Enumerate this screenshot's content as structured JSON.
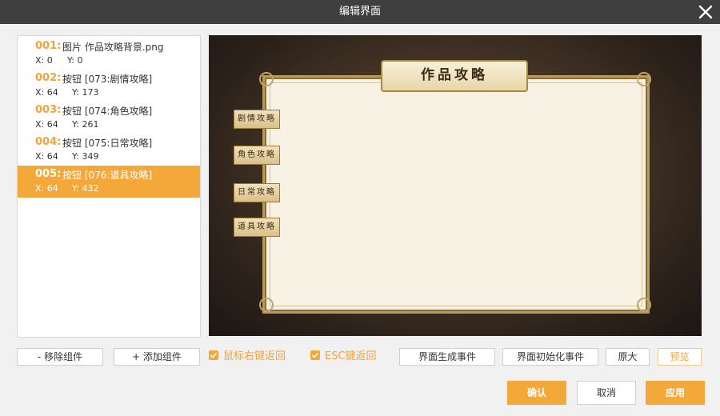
{
  "window": {
    "title": "编辑界面"
  },
  "components": [
    {
      "index": "001:",
      "name": "图片 作品攻略背景.png",
      "x_label": "X:",
      "x": "0",
      "y_label": "Y:",
      "y": "0",
      "selected": false
    },
    {
      "index": "002:",
      "name": "按钮 [073:剧情攻略]",
      "x_label": "X:",
      "x": "64",
      "y_label": "Y:",
      "y": "173",
      "selected": false
    },
    {
      "index": "003:",
      "name": "按钮 [074:角色攻略]",
      "x_label": "X:",
      "x": "64",
      "y_label": "Y:",
      "y": "261",
      "selected": false
    },
    {
      "index": "004:",
      "name": "按钮 [075:日常攻略]",
      "x_label": "X:",
      "x": "64",
      "y_label": "Y:",
      "y": "349",
      "selected": false
    },
    {
      "index": "005:",
      "name": "按钮 [076:道具攻略]",
      "x_label": "X:",
      "x": "64",
      "y_label": "Y:",
      "y": "432",
      "selected": true
    }
  ],
  "preview": {
    "panel_title": "作品攻略",
    "buttons": [
      "剧情攻略",
      "角色攻略",
      "日常攻略",
      "道具攻略"
    ]
  },
  "toolbar": {
    "remove": "- 移除组件",
    "add": "+ 添加组件",
    "right_click_back": "鼠标右键返回",
    "esc_back": "ESC键返回",
    "gen_event": "界面生成事件",
    "init_event": "界面初始化事件",
    "original_size": "原大",
    "preview": "预览"
  },
  "footer": {
    "confirm": "确认",
    "cancel": "取消",
    "apply": "应用"
  },
  "colors": {
    "accent": "#f4a83a",
    "titlebar": "#3f3f3f"
  },
  "icons": {
    "close": "close-icon",
    "check": "check-icon"
  }
}
